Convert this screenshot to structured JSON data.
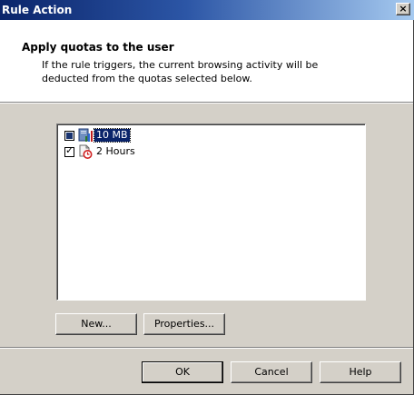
{
  "window": {
    "title": "Rule Action",
    "close_label": "×"
  },
  "header": {
    "title": "Apply quotas to the user",
    "description": "If the rule triggers, the current browsing activity will be deducted from the quotas selected below."
  },
  "quotas": [
    {
      "label": "10 MB",
      "checked": "partial",
      "selected": true,
      "icon": "size-quota-icon"
    },
    {
      "label": "2 Hours",
      "checked": true,
      "selected": false,
      "icon": "time-quota-icon"
    }
  ],
  "buttons": {
    "new": "New...",
    "properties": "Properties...",
    "ok": "OK",
    "cancel": "Cancel",
    "help": "Help"
  }
}
